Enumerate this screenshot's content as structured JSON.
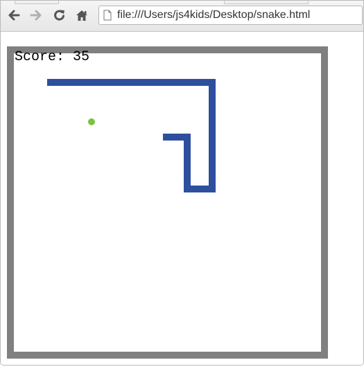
{
  "browser": {
    "url": "file:///Users/js4kids/Desktop/snake.html",
    "icons": {
      "back": "back-arrow-icon",
      "forward": "forward-arrow-icon",
      "reload": "reload-icon",
      "home": "home-icon",
      "page": "page-icon"
    }
  },
  "game": {
    "score_label": "Score:",
    "score": 35,
    "score_text": "Score: 35",
    "colors": {
      "border": "#808080",
      "board": "#ffffff",
      "snake": "#2e4f9e",
      "apple": "#7cc242",
      "text": "#000000"
    }
  }
}
